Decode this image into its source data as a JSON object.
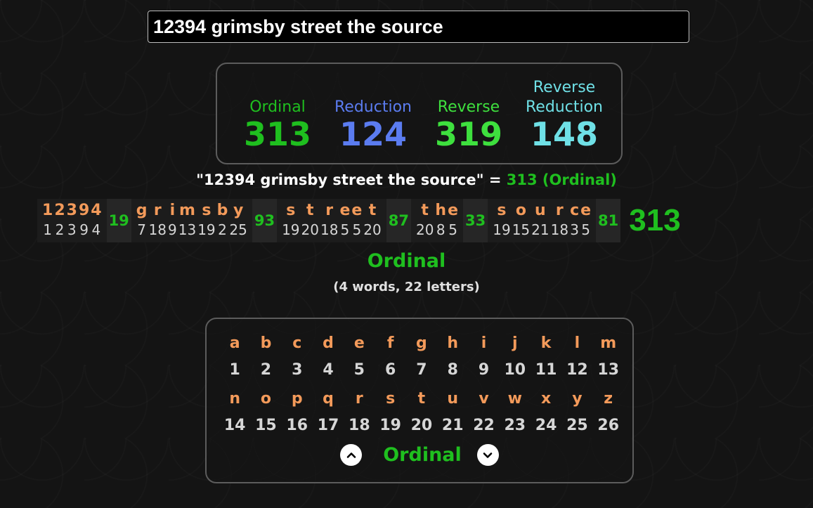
{
  "search": {
    "value": "12394 grimsby street the source"
  },
  "ciphers": [
    {
      "name": "Ordinal",
      "value": "313",
      "color": "#1fbf1f"
    },
    {
      "name": "Reduction",
      "value": "124",
      "color": "#5b7cf0"
    },
    {
      "name": "Reverse",
      "value": "319",
      "color": "#3ee03e"
    },
    {
      "name": "Reverse Reduction",
      "value": "148",
      "color": "#6fe0e6"
    }
  ],
  "summary": {
    "phrase": "\"12394 grimsby street the source\"",
    "equals": " = ",
    "result": "313 (Ordinal)"
  },
  "breakdown": {
    "words": [
      {
        "letters": [
          "1",
          "2",
          "3",
          "9",
          "4"
        ],
        "values": [
          "1",
          "2",
          "3",
          "9",
          "4"
        ],
        "sum": "19"
      },
      {
        "letters": [
          "g",
          "r",
          "i",
          "m",
          "s",
          "b",
          "y"
        ],
        "values": [
          "7",
          "18",
          "9",
          "13",
          "19",
          "2",
          "25"
        ],
        "sum": "93"
      },
      {
        "letters": [
          "s",
          "t",
          "r",
          "e",
          "e",
          "t"
        ],
        "values": [
          "19",
          "20",
          "18",
          "5",
          "5",
          "20"
        ],
        "sum": "87"
      },
      {
        "letters": [
          "t",
          "h",
          "e"
        ],
        "values": [
          "20",
          "8",
          "5"
        ],
        "sum": "33"
      },
      {
        "letters": [
          "s",
          "o",
          "u",
          "r",
          "c",
          "e"
        ],
        "values": [
          "19",
          "15",
          "21",
          "18",
          "3",
          "5"
        ],
        "sum": "81"
      }
    ],
    "total": "313"
  },
  "cipher_title": "Ordinal",
  "word_count": "(4 words, 22 letters)",
  "chart": {
    "row1_letters": [
      "a",
      "b",
      "c",
      "d",
      "e",
      "f",
      "g",
      "h",
      "i",
      "j",
      "k",
      "l",
      "m"
    ],
    "row1_values": [
      "1",
      "2",
      "3",
      "4",
      "5",
      "6",
      "7",
      "8",
      "9",
      "10",
      "11",
      "12",
      "13"
    ],
    "row2_letters": [
      "n",
      "o",
      "p",
      "q",
      "r",
      "s",
      "t",
      "u",
      "v",
      "w",
      "x",
      "y",
      "z"
    ],
    "row2_values": [
      "14",
      "15",
      "16",
      "17",
      "18",
      "19",
      "20",
      "21",
      "22",
      "23",
      "24",
      "25",
      "26"
    ],
    "nav_label": "Ordinal",
    "up_icon": "chevron-up-icon",
    "down_icon": "chevron-down-icon"
  }
}
